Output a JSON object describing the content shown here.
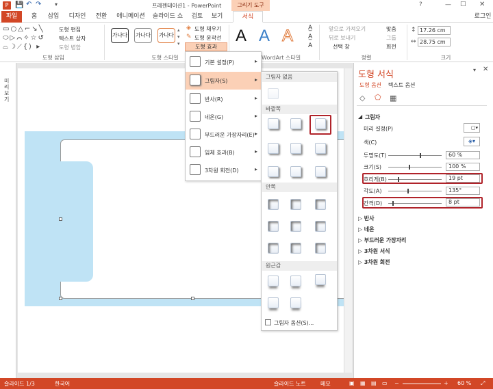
{
  "app": {
    "title": "프레젠테이션1 - PowerPoint",
    "context_tab": "그리기 도구",
    "login": "로그인"
  },
  "tabs": [
    "파일",
    "홈",
    "삽입",
    "디자인",
    "전환",
    "애니메이션",
    "슬라이드 쇼",
    "검토",
    "보기",
    "서식"
  ],
  "ribbon": {
    "insert_shapes": {
      "label": "도형 삽입",
      "edit_shape": "도형 편집",
      "text_box": "텍스트 상자",
      "merge": "도형 병합"
    },
    "shape_styles": {
      "label": "도형 스타일",
      "sample": "가나다",
      "fill": "도형 채우기",
      "outline": "도형 윤곽선",
      "effects": "도형 효과"
    },
    "wordart": {
      "label": "WordArt 스타일",
      "letters": [
        "A",
        "A",
        "A"
      ]
    },
    "arrange": {
      "label": "정렬",
      "forward": "앞으로 가져오기",
      "backward": "뒤로 보내기",
      "selection": "선택 창",
      "align": "맞춤",
      "group": "그룹",
      "rotate": "회전"
    },
    "size": {
      "label": "크기",
      "height": "17.26 cm",
      "width": "28.75 cm"
    }
  },
  "effects_menu": {
    "items": [
      "기본 설정(P)",
      "그림자(S)",
      "반사(R)",
      "네온(G)",
      "부드러운 가장자리(E)",
      "입체 효과(B)",
      "3차원 회전(D)"
    ]
  },
  "shadow_gallery": {
    "none": "그림자 없음",
    "outer": "바깥쪽",
    "inner": "안쪽",
    "perspective": "원근감",
    "options": "그림자 옵션(S)..."
  },
  "format_pane": {
    "title": "도형 서식",
    "tab_shape": "도형 옵션",
    "tab_text": "텍스트 옵션",
    "section": "그림자",
    "preset": "미리 설정(P)",
    "color": "색(C)",
    "transparency": "투명도(T)",
    "size": "크기(S)",
    "blur": "흐리게(B)",
    "angle": "각도(A)",
    "distance": "간격(D)",
    "values": {
      "transparency": "60 %",
      "size": "100 %",
      "blur": "19 pt",
      "angle": "135°",
      "distance": "8 pt"
    },
    "sliders": {
      "transparency": 60,
      "size": 40,
      "blur": 19,
      "angle": 37,
      "distance": 8
    },
    "collapsed": [
      "반사",
      "네온",
      "부드러운 가장자리",
      "3차원 서식",
      "3차원 회전"
    ]
  },
  "status": {
    "slide": "슬라이드 1/3",
    "lang": "한국어",
    "notes": "슬라이드 노트",
    "memo": "메모",
    "zoom": "60 %"
  },
  "left_pane": {
    "label": "미리보기"
  },
  "colors": {
    "accent": "#d24726",
    "shape_fill": "#bfe3f5",
    "highlight": "#fbd0b6"
  }
}
